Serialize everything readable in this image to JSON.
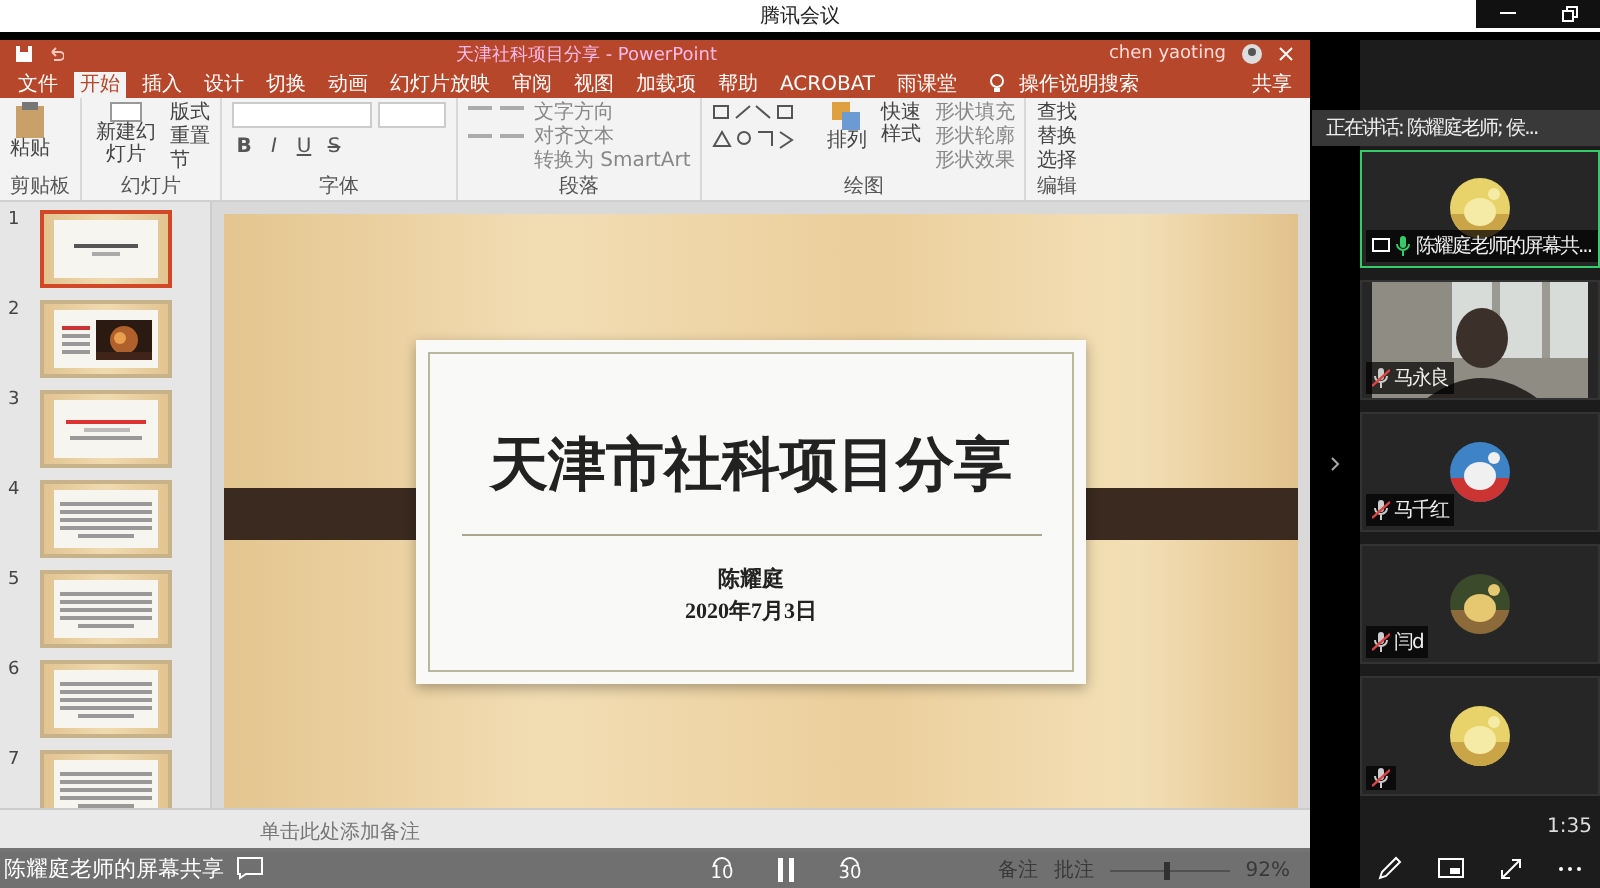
{
  "app_title": "腾讯会议",
  "ppt": {
    "title": "天津社科项目分享 - PowerPoint",
    "user": "chen yaoting",
    "menu_tabs": [
      {
        "label": "文件",
        "selected": false
      },
      {
        "label": "开始",
        "selected": true
      },
      {
        "label": "插入",
        "selected": false
      },
      {
        "label": "设计",
        "selected": false
      },
      {
        "label": "切换",
        "selected": false
      },
      {
        "label": "动画",
        "selected": false
      },
      {
        "label": "幻灯片放映",
        "selected": false
      },
      {
        "label": "审阅",
        "selected": false
      },
      {
        "label": "视图",
        "selected": false
      },
      {
        "label": "加载项",
        "selected": false
      },
      {
        "label": "帮助",
        "selected": false
      },
      {
        "label": "ACROBAT",
        "selected": false
      },
      {
        "label": "雨课堂",
        "selected": false
      }
    ],
    "tell_me": "操作说明搜索",
    "share": "共享",
    "ribbon": {
      "clipboard": {
        "label": "剪贴板",
        "paste": "粘贴"
      },
      "slides": {
        "label": "幻灯片",
        "new_slide": "新建幻灯片",
        "buttons": [
          "版式",
          "重置",
          "节"
        ]
      },
      "font": {
        "label": "字体",
        "format_buttons": [
          "B",
          "I",
          "U",
          "S"
        ]
      },
      "paragraph": {
        "label": "段落",
        "buttons": [
          "文字方向",
          "对齐文本",
          "转换为 SmartArt"
        ]
      },
      "drawing": {
        "label": "绘图",
        "arrange": "排列",
        "quick_styles": "快速样式",
        "buttons": [
          "形状填充",
          "形状轮廓",
          "形状效果"
        ]
      },
      "editing": {
        "label": "编辑",
        "buttons": [
          "查找",
          "替换",
          "选择"
        ]
      }
    },
    "slides": [
      {
        "number": "1",
        "kind": "title",
        "selected": true
      },
      {
        "number": "2",
        "selected": false
      },
      {
        "number": "3",
        "kind": "heading",
        "selected": false
      },
      {
        "number": "4",
        "kind": "text",
        "selected": false
      },
      {
        "number": "5",
        "kind": "text",
        "selected": false
      },
      {
        "number": "6",
        "kind": "text",
        "selected": false
      },
      {
        "number": "7",
        "kind": "text",
        "selected": false
      }
    ],
    "slide": {
      "title": "天津市社科项目分享",
      "author": "陈耀庭",
      "date": "2020年7月3日"
    },
    "notes_placeholder": "单击此处添加备注",
    "status": {
      "notes": "备注",
      "comments": "批注",
      "zoom": "92%",
      "zoom_slider": {
        "level": 0.45
      }
    }
  },
  "share_caption": "陈耀庭老师的屏幕共享",
  "playback": {
    "back": "10",
    "forward": "30"
  },
  "meeting": {
    "speaking": "正在讲话: 陈耀庭老师; 侯...",
    "participants": [
      {
        "name": "陈耀庭老师的屏幕共...",
        "kind": "avatar",
        "sharing": true,
        "muted": false
      },
      {
        "name": "马永良",
        "kind": "video",
        "sharing": false,
        "muted": true
      },
      {
        "name": "马千红",
        "kind": "avatar",
        "sharing": false,
        "muted": true
      },
      {
        "name": "闫d",
        "kind": "avatar",
        "sharing": false,
        "muted": true
      },
      {
        "kind": "avatar",
        "sharing": false,
        "muted": true
      }
    ],
    "timer": "1:35"
  }
}
